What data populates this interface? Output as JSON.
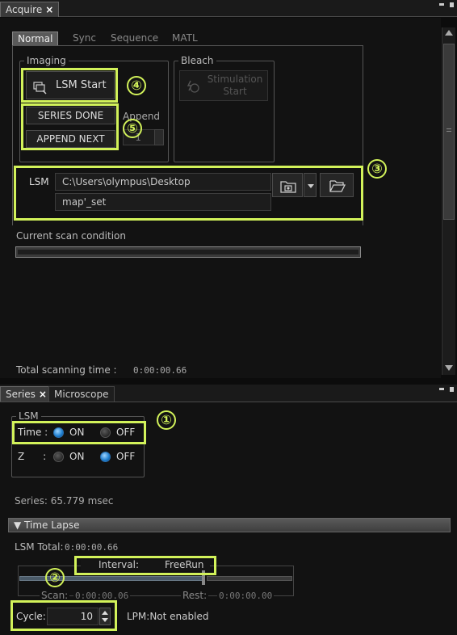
{
  "acquire_panel": {
    "tab_label": "Acquire",
    "close_glyph": "×",
    "inner_tabs": [
      "Normal",
      "Sync",
      "Sequence",
      "MATL"
    ],
    "imaging": {
      "group_label": "Imaging",
      "lsm_start_label": "LSM Start",
      "series_done_label": "SERIES DONE",
      "append_next_label": "APPEND NEXT",
      "append_label": "Append",
      "append_value": "1"
    },
    "bleach": {
      "group_label": "Bleach",
      "stimulation_label_1": "Stimulation",
      "stimulation_label_2": "Start"
    },
    "lsm": {
      "label": "LSM",
      "path_value": "C:\\Users\\olympus\\Desktop",
      "name_value": "map'_set"
    },
    "current_scan_label": "Current scan condition",
    "total_time_label": "Total scanning time :",
    "total_time_value": "0:00:00.66"
  },
  "series_panel": {
    "tab_series": "Series",
    "close_glyph": "×",
    "tab_microscope": "Microscope",
    "lsm_group_label": "LSM",
    "time_label": "Time :",
    "z_label": "Z      :",
    "on_label": "ON",
    "off_label": "OFF",
    "time_state": "ON",
    "z_state": "OFF",
    "series_info": "Series: 65.779 msec"
  },
  "time_lapse": {
    "header": "▼ Time Lapse",
    "lsm_total_label": "LSM Total:",
    "lsm_total_value": "0:00:00.66",
    "interval_label": "Interval:",
    "interval_value": "FreeRun",
    "scan_label": "Scan:",
    "scan_value": "0:00:00.06",
    "rest_label": "Rest:",
    "rest_value": "0:00:00.00",
    "cycle_label": "Cycle:",
    "cycle_value": "10",
    "lpm_status": "LPM:Not enabled"
  },
  "annotations": [
    "④",
    "⑤",
    "③",
    "①",
    "②"
  ],
  "colors": {
    "highlight": "#d2f25a",
    "radio_on": "#1e7fd0",
    "background": "#121212"
  },
  "icons": [
    "lsm-start-icon",
    "stimulation-icon",
    "folder-camera-icon",
    "dropdown-arrow-icon",
    "folder-open-icon",
    "spin-up-icon",
    "spin-down-icon",
    "scroll-up-icon",
    "scroll-down-icon"
  ]
}
